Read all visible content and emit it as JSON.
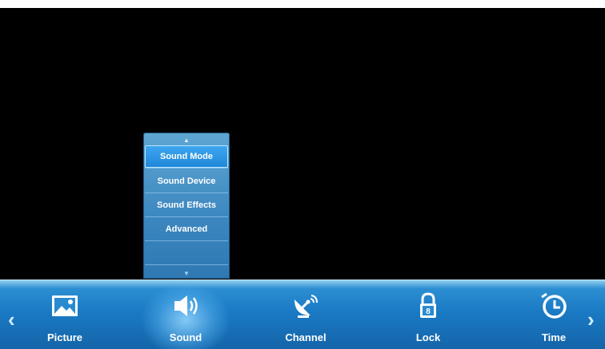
{
  "submenu": {
    "scroll_up_glyph": "▲",
    "scroll_down_glyph": "▼",
    "items": [
      {
        "label": "Sound Mode",
        "selected": true
      },
      {
        "label": "Sound Device",
        "selected": false
      },
      {
        "label": "Sound Effects",
        "selected": false
      },
      {
        "label": "Advanced",
        "selected": false
      }
    ]
  },
  "menu_bar": {
    "left_arrow": "‹",
    "right_arrow": "›",
    "items": [
      {
        "label": "Picture",
        "icon": "picture-icon"
      },
      {
        "label": "Sound",
        "icon": "speaker-icon",
        "active": true
      },
      {
        "label": "Channel",
        "icon": "satellite-dish-icon"
      },
      {
        "label": "Lock",
        "icon": "padlock-icon"
      },
      {
        "label": "Time",
        "icon": "clock-icon"
      }
    ]
  },
  "colors": {
    "menu_bar_blue": "#1a7ac4",
    "submenu_blue": "#3b86bf",
    "selected_item": "#1f86d8",
    "background": "#000000"
  }
}
